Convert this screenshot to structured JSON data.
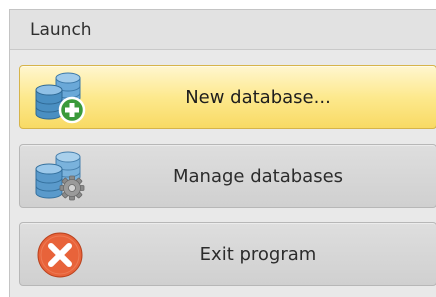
{
  "panel": {
    "title": "Launch"
  },
  "buttons": {
    "new_database": {
      "label": "New database...",
      "icon": "database-add-icon",
      "state": "hover"
    },
    "manage_databases": {
      "label": "Manage databases",
      "icon": "database-settings-icon"
    },
    "exit_program": {
      "label": "Exit program",
      "icon": "exit-icon"
    }
  },
  "colors": {
    "highlight": "#fde98e",
    "database_blue": "#4a8fc2",
    "add_green": "#3a9a3a",
    "exit_orange": "#e8633a"
  }
}
